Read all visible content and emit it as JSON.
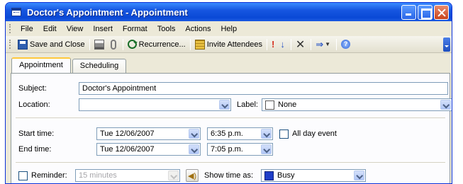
{
  "window": {
    "title": "Doctor's Appointment - Appointment",
    "min_icon": "minimize-icon",
    "max_icon": "maximize-icon",
    "close_icon": "close-icon"
  },
  "menu": {
    "items": [
      "File",
      "Edit",
      "View",
      "Insert",
      "Format",
      "Tools",
      "Actions",
      "Help"
    ]
  },
  "toolbar": {
    "save_close": "Save and Close",
    "recurrence": "Recurrence...",
    "invite": "Invite Attendees",
    "icons": [
      "save-icon",
      "print-icon",
      "attach-icon",
      "recurrence-icon",
      "invite-icon",
      "importance-high-icon",
      "importance-low-icon",
      "delete-icon",
      "categorize-icon",
      "help-icon"
    ]
  },
  "tabs": [
    "Appointment",
    "Scheduling"
  ],
  "form": {
    "subject_label": "Subject:",
    "subject_value": "Doctor's Appointment",
    "location_label": "Location:",
    "location_value": "",
    "label_label": "Label:",
    "label_value": "None",
    "start_label": "Start time:",
    "start_date": "Tue 12/06/2007",
    "start_time": "6:35 p.m.",
    "all_day": "All day event",
    "end_label": "End time:",
    "end_date": "Tue 12/06/2007",
    "end_time": "7:05 p.m.",
    "reminder_label": "Reminder:",
    "reminder_value": "15 minutes",
    "show_time_label": "Show time as:",
    "show_time_value": "Busy"
  },
  "colors": {
    "busy": "#1f3ec8",
    "titlebar": "#0a49d6"
  }
}
